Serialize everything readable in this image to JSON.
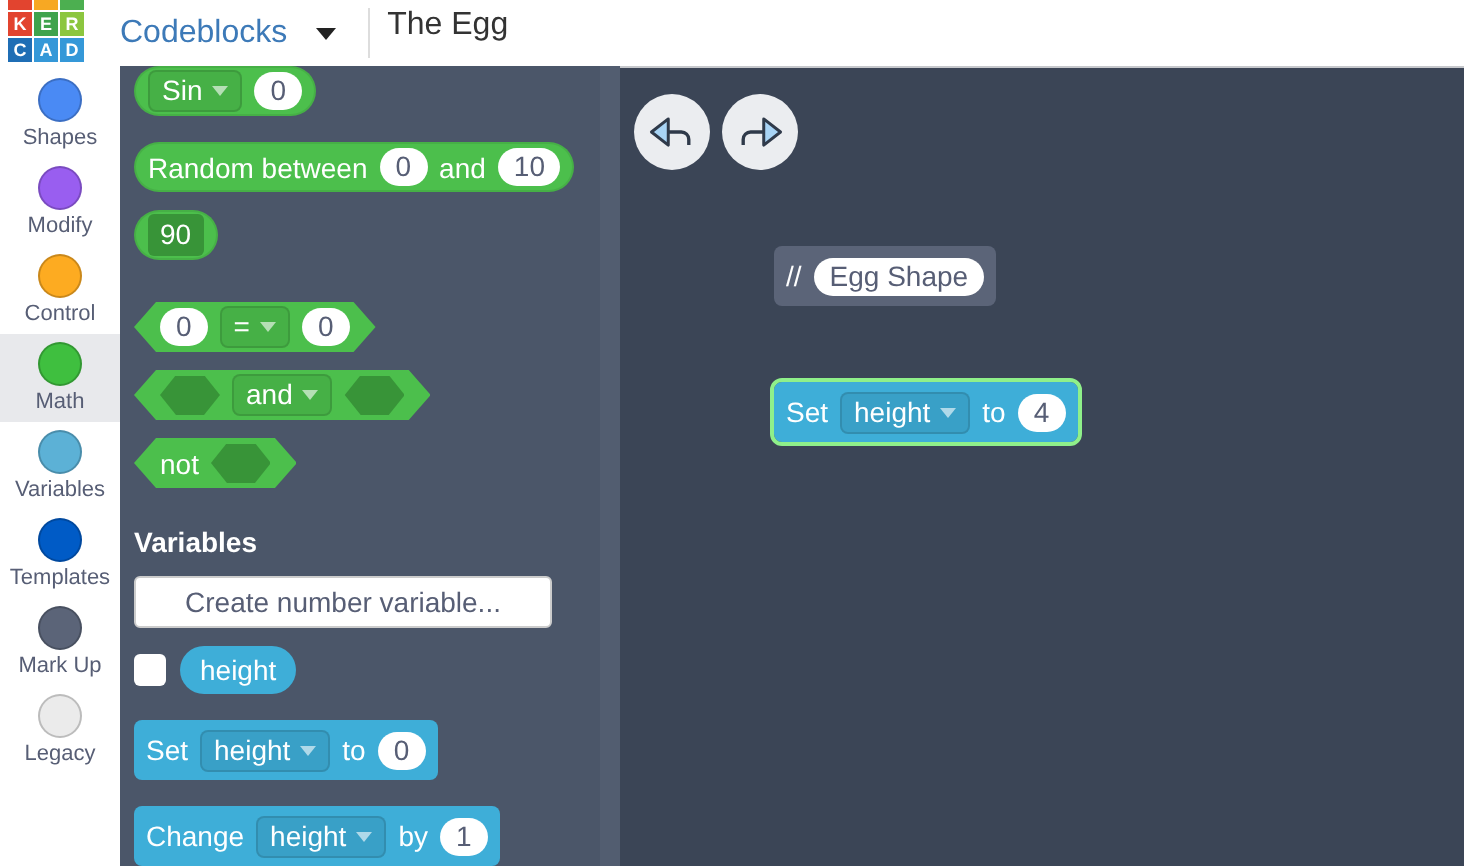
{
  "header": {
    "logo_rows": [
      [
        "K",
        "E",
        "R"
      ],
      [
        "C",
        "A",
        "D"
      ]
    ],
    "app_title": "Codeblocks",
    "design_name": "The Egg"
  },
  "categories": [
    {
      "label": "Shapes",
      "color": "#4a8af4",
      "selected": false
    },
    {
      "label": "Modify",
      "color": "#995ef0",
      "selected": false
    },
    {
      "label": "Control",
      "color": "#fdab21",
      "selected": false
    },
    {
      "label": "Math",
      "color": "#3fbf3f",
      "selected": true
    },
    {
      "label": "Variables",
      "color": "#5cb1d6",
      "selected": false
    },
    {
      "label": "Templates",
      "color": "#005bc6",
      "selected": false
    },
    {
      "label": "Mark Up",
      "color": "#5b6478",
      "selected": false
    },
    {
      "label": "Legacy",
      "color": "#ebebeb",
      "selected": false
    }
  ],
  "palette": {
    "blocks": [
      {
        "kind": "pill",
        "color": "#4cbf4c",
        "parts": [
          {
            "kind": "dropdown",
            "text": "Sin"
          },
          {
            "kind": "input",
            "text": "0"
          }
        ]
      },
      {
        "kind": "pill",
        "color": "#4cbf4c",
        "parts": [
          {
            "kind": "text",
            "text": "Random between"
          },
          {
            "kind": "input",
            "text": "0"
          },
          {
            "kind": "text",
            "text": "and"
          },
          {
            "kind": "input",
            "text": "10"
          }
        ]
      },
      {
        "kind": "pill",
        "color": "#4cbf4c",
        "parts": [
          {
            "kind": "field",
            "text": "90"
          }
        ]
      },
      {
        "kind": "hex",
        "color": "#4cbf4c",
        "parts": [
          {
            "kind": "input",
            "text": "0"
          },
          {
            "kind": "dropdown",
            "text": "="
          },
          {
            "kind": "input",
            "text": "0"
          }
        ]
      },
      {
        "kind": "hex",
        "color": "#4cbf4c",
        "parts": [
          {
            "kind": "slot"
          },
          {
            "kind": "dropdown",
            "text": "and"
          },
          {
            "kind": "slot"
          }
        ]
      },
      {
        "kind": "hex",
        "color": "#4cbf4c",
        "parts": [
          {
            "kind": "text",
            "text": "not"
          },
          {
            "kind": "slot"
          }
        ]
      }
    ],
    "variables_heading": "Variables",
    "create_variable_button": "Create number variable...",
    "variable": {
      "name": "height",
      "checked": false
    },
    "variable_blocks": [
      {
        "kind": "stack",
        "color": "#3eaed8",
        "parts": [
          {
            "kind": "text",
            "text": "Set"
          },
          {
            "kind": "dropdown",
            "text": "height"
          },
          {
            "kind": "text",
            "text": "to"
          },
          {
            "kind": "input",
            "text": "0"
          }
        ]
      },
      {
        "kind": "stack",
        "color": "#3eaed8",
        "parts": [
          {
            "kind": "text",
            "text": "Change"
          },
          {
            "kind": "dropdown",
            "text": "height"
          },
          {
            "kind": "text",
            "text": "by"
          },
          {
            "kind": "input",
            "text": "1"
          }
        ]
      }
    ]
  },
  "canvas": {
    "blocks": [
      {
        "kind": "stack",
        "color": "#5b6478",
        "highlighted": false,
        "parts": [
          {
            "kind": "text",
            "text": "//"
          },
          {
            "kind": "input",
            "text": "Egg Shape"
          }
        ]
      },
      {
        "kind": "stack",
        "color": "#3eaed8",
        "highlighted": true,
        "parts": [
          {
            "kind": "text",
            "text": "Set"
          },
          {
            "kind": "dropdown",
            "text": "height"
          },
          {
            "kind": "text",
            "text": "to"
          },
          {
            "kind": "input",
            "text": "4"
          }
        ]
      }
    ]
  }
}
